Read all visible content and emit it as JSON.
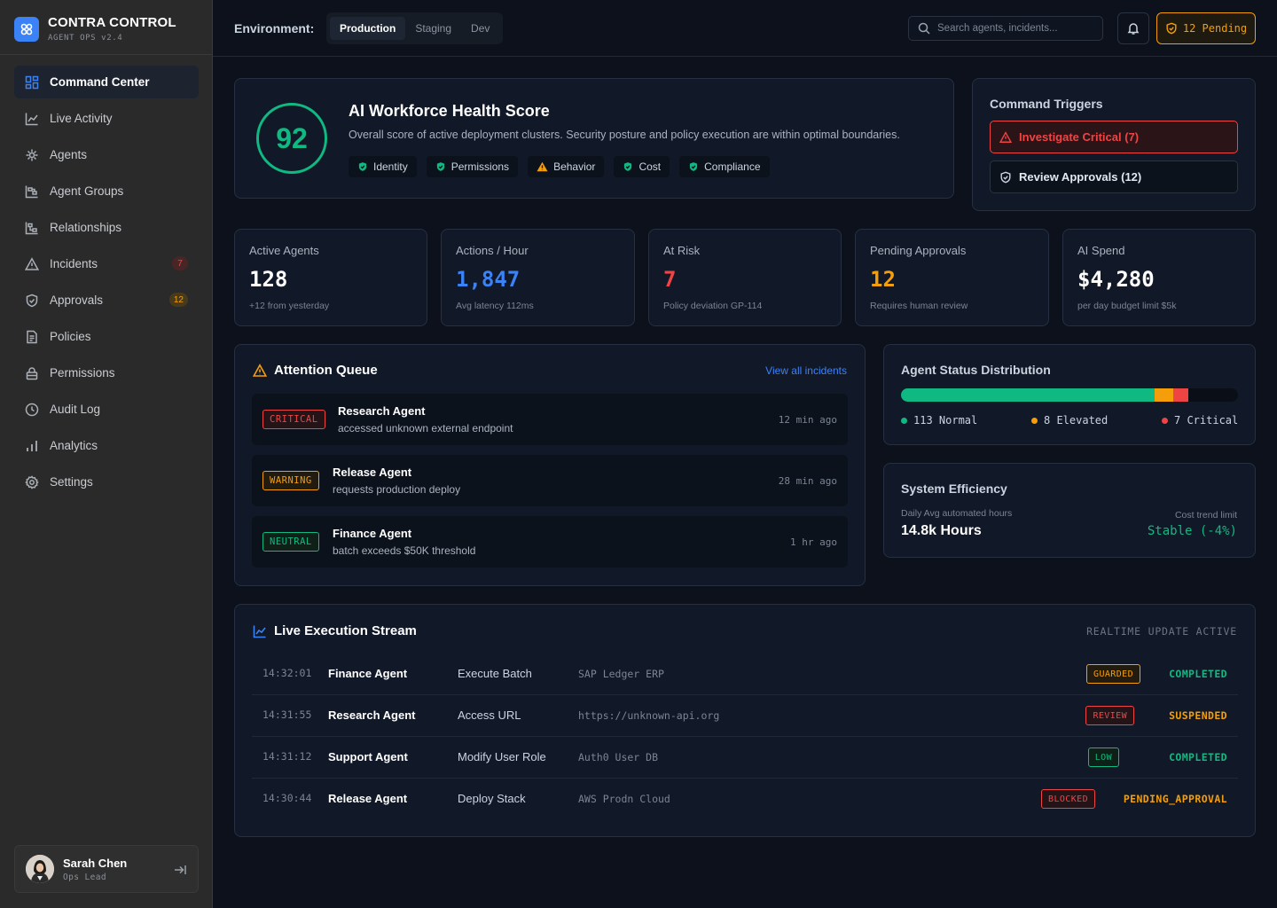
{
  "brand": {
    "name": "CONTRA CONTROL",
    "subtitle": "AGENT OPS v2.4"
  },
  "nav": [
    {
      "label": "Command Center",
      "icon": "grid-icon",
      "active": true
    },
    {
      "label": "Live Activity",
      "icon": "activity-chart-icon"
    },
    {
      "label": "Agents",
      "icon": "agents-icon"
    },
    {
      "label": "Agent Groups",
      "icon": "groups-icon"
    },
    {
      "label": "Relationships",
      "icon": "relationships-icon"
    },
    {
      "label": "Incidents",
      "icon": "warning-icon",
      "badge": "7"
    },
    {
      "label": "Approvals",
      "icon": "shield-icon",
      "badge": "12"
    },
    {
      "label": "Policies",
      "icon": "document-icon"
    },
    {
      "label": "Permissions",
      "icon": "lock-icon"
    },
    {
      "label": "Audit Log",
      "icon": "clock-icon"
    },
    {
      "label": "Analytics",
      "icon": "bar-chart-icon"
    },
    {
      "label": "Settings",
      "icon": "gear-icon"
    }
  ],
  "user": {
    "name": "Sarah Chen",
    "role": "Ops Lead"
  },
  "header": {
    "env_label": "Environment:",
    "env_tabs": [
      "Production",
      "Staging",
      "Dev"
    ],
    "search_placeholder": "Search agents, incidents...",
    "pending_label": "12 Pending"
  },
  "health": {
    "score": "92",
    "title": "AI Workforce Health Score",
    "description": "Overall score of active deployment clusters. Security posture and policy execution are within optimal boundaries.",
    "chips": [
      {
        "label": "Identity",
        "status": "ok"
      },
      {
        "label": "Permissions",
        "status": "ok"
      },
      {
        "label": "Behavior",
        "status": "warn"
      },
      {
        "label": "Cost",
        "status": "ok"
      },
      {
        "label": "Compliance",
        "status": "ok"
      }
    ]
  },
  "triggers": {
    "title": "Command Triggers",
    "investigate": "Investigate Critical (7)",
    "review": "Review Approvals (12)"
  },
  "stats": [
    {
      "label": "Active Agents",
      "value": "128",
      "sub": "+12 from yesterday",
      "color": "#ffffff"
    },
    {
      "label": "Actions / Hour",
      "value": "1,847",
      "sub": "Avg latency 112ms",
      "color": "#3b82f6"
    },
    {
      "label": "At Risk",
      "value": "7",
      "sub": "Policy deviation GP-114",
      "color": "#ef4444"
    },
    {
      "label": "Pending Approvals",
      "value": "12",
      "sub": "Requires human review",
      "color": "#f59e0b"
    },
    {
      "label": "AI Spend",
      "value": "$4,280",
      "sub": "per day budget limit $5k",
      "color": "#ffffff"
    }
  ],
  "queue": {
    "title": "Attention Queue",
    "view_all": "View all incidents",
    "items": [
      {
        "badge": "CRITICAL",
        "level": "crit",
        "name": "Research Agent",
        "desc": "accessed unknown external endpoint",
        "time": "12 min ago"
      },
      {
        "badge": "WARNING",
        "level": "warn",
        "name": "Release Agent",
        "desc": "requests production deploy",
        "time": "28 min ago"
      },
      {
        "badge": "NEUTRAL",
        "level": "neut",
        "name": "Finance Agent",
        "desc": "batch exceeds $50K threshold",
        "time": "1 hr ago"
      }
    ]
  },
  "distribution": {
    "title": "Agent Status Distribution",
    "segments": [
      {
        "label": "113 Normal",
        "count": 113,
        "color": "#10b981"
      },
      {
        "label": "8 Elevated",
        "count": 8,
        "color": "#f59e0b"
      },
      {
        "label": "7 Critical",
        "count": 7,
        "color": "#ef4444"
      }
    ],
    "total_scale": 150
  },
  "efficiency": {
    "title": "System Efficiency",
    "left_label": "Daily Avg automated hours",
    "left_value": "14.8k Hours",
    "right_label": "Cost trend limit",
    "right_value": "Stable (-4%)"
  },
  "stream": {
    "title": "Live Execution Stream",
    "realtime": "REALTIME UPDATE ACTIVE",
    "rows": [
      {
        "time": "14:32:01",
        "agent": "Finance Agent",
        "action": "Execute Batch",
        "target": "SAP Ledger ERP",
        "badge": "GUARDED",
        "badge_color": "#f59e0b",
        "status": "COMPLETED",
        "status_color": "#10b981"
      },
      {
        "time": "14:31:55",
        "agent": "Research Agent",
        "action": "Access URL",
        "target": "https://unknown-api.org",
        "badge": "REVIEW",
        "badge_color": "#ef4444",
        "status": "SUSPENDED",
        "status_color": "#f59e0b"
      },
      {
        "time": "14:31:12",
        "agent": "Support Agent",
        "action": "Modify User Role",
        "target": "Auth0 User DB",
        "badge": "LOW",
        "badge_color": "#10b981",
        "status": "COMPLETED",
        "status_color": "#10b981"
      },
      {
        "time": "14:30:44",
        "agent": "Release Agent",
        "action": "Deploy Stack",
        "target": "AWS Prodn Cloud",
        "badge": "BLOCKED",
        "badge_color": "#ef4444",
        "status": "PENDING_APPROVAL",
        "status_color": "#f59e0b"
      }
    ]
  }
}
